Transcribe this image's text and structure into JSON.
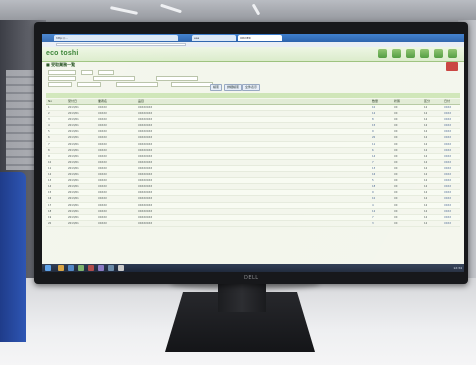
{
  "browser": {
    "tabs": [
      {
        "label": "http://...",
        "active": false
      },
      {
        "label": "esa",
        "active": false
      },
      {
        "label": "ORDER",
        "active": true
      }
    ]
  },
  "app": {
    "logo_text": "eco toshi",
    "brand_color": "#2f7d2a",
    "header_icons": [
      "app-icon",
      "app-icon",
      "app-icon",
      "app-icon",
      "app-icon",
      "app-icon"
    ]
  },
  "section": {
    "title": "■ 受取業務一覧"
  },
  "buttons": [
    {
      "label": "検索"
    },
    {
      "label": "詳細検索"
    },
    {
      "label": "全件表示"
    }
  ],
  "table": {
    "columns": [
      "No",
      "受付日",
      "業者名",
      "品目",
      "数量",
      "状態",
      "区分",
      "日付"
    ],
    "rows": [
      {
        "cells": [
          "1",
          "2013/01",
          "XXXXX",
          "XXXXXXXX",
          "10",
          "XX",
          "12",
          "XXXX"
        ]
      },
      {
        "cells": [
          "2",
          "2013/01",
          "XXXXX",
          "XXXXXXXX",
          "12",
          "XX",
          "12",
          "XXXX"
        ]
      },
      {
        "cells": [
          "3",
          "2013/01",
          "XXXXX",
          "XXXXXXXX",
          "8",
          "XX",
          "12",
          "XXXX"
        ]
      },
      {
        "cells": [
          "4",
          "2013/01",
          "XXXXX",
          "XXXXXXXX",
          "15",
          "XX",
          "12",
          "XXXX"
        ]
      },
      {
        "cells": [
          "5",
          "2013/01",
          "XXXXX",
          "XXXXXXXX",
          "9",
          "XX",
          "12",
          "XXXX"
        ]
      },
      {
        "cells": [
          "6",
          "2013/01",
          "XXXXX",
          "XXXXXXXX",
          "20",
          "XX",
          "12",
          "XXXX"
        ]
      },
      {
        "cells": [
          "7",
          "2013/01",
          "XXXXX",
          "XXXXXXXX",
          "11",
          "XX",
          "12",
          "XXXX"
        ]
      },
      {
        "cells": [
          "8",
          "2013/01",
          "XXXXX",
          "XXXXXXXX",
          "6",
          "XX",
          "12",
          "XXXX"
        ]
      },
      {
        "cells": [
          "9",
          "2013/01",
          "XXXXX",
          "XXXXXXXX",
          "14",
          "XX",
          "12",
          "XXXX"
        ]
      },
      {
        "cells": [
          "10",
          "2013/01",
          "XXXXX",
          "XXXXXXXX",
          "7",
          "XX",
          "12",
          "XXXX"
        ]
      },
      {
        "cells": [
          "11",
          "2013/01",
          "XXXXX",
          "XXXXXXXX",
          "13",
          "XX",
          "12",
          "XXXX"
        ]
      },
      {
        "cells": [
          "12",
          "2013/01",
          "XXXXX",
          "XXXXXXXX",
          "16",
          "XX",
          "12",
          "XXXX"
        ]
      },
      {
        "cells": [
          "13",
          "2013/01",
          "XXXXX",
          "XXXXXXXX",
          "5",
          "XX",
          "12",
          "XXXX"
        ]
      },
      {
        "cells": [
          "14",
          "2013/01",
          "XXXXX",
          "XXXXXXXX",
          "18",
          "XX",
          "12",
          "XXXX"
        ]
      },
      {
        "cells": [
          "15",
          "2013/01",
          "XXXXX",
          "XXXXXXXX",
          "9",
          "XX",
          "12",
          "XXXX"
        ]
      },
      {
        "cells": [
          "16",
          "2013/01",
          "XXXXX",
          "XXXXXXXX",
          "10",
          "XX",
          "12",
          "XXXX"
        ]
      },
      {
        "cells": [
          "17",
          "2013/01",
          "XXXXX",
          "XXXXXXXX",
          "4",
          "XX",
          "12",
          "XXXX"
        ]
      },
      {
        "cells": [
          "18",
          "2013/01",
          "XXXXX",
          "XXXXXXXX",
          "12",
          "XX",
          "12",
          "XXXX"
        ]
      },
      {
        "cells": [
          "19",
          "2013/01",
          "XXXXX",
          "XXXXXXXX",
          "7",
          "XX",
          "12",
          "XXXX"
        ]
      },
      {
        "cells": [
          "20",
          "2013/01",
          "XXXXX",
          "XXXXXXXX",
          "3",
          "XX",
          "12",
          "XXXX"
        ]
      }
    ]
  },
  "taskbar": {
    "tray_text": "12:34"
  },
  "monitor": {
    "brand": "DELL"
  }
}
